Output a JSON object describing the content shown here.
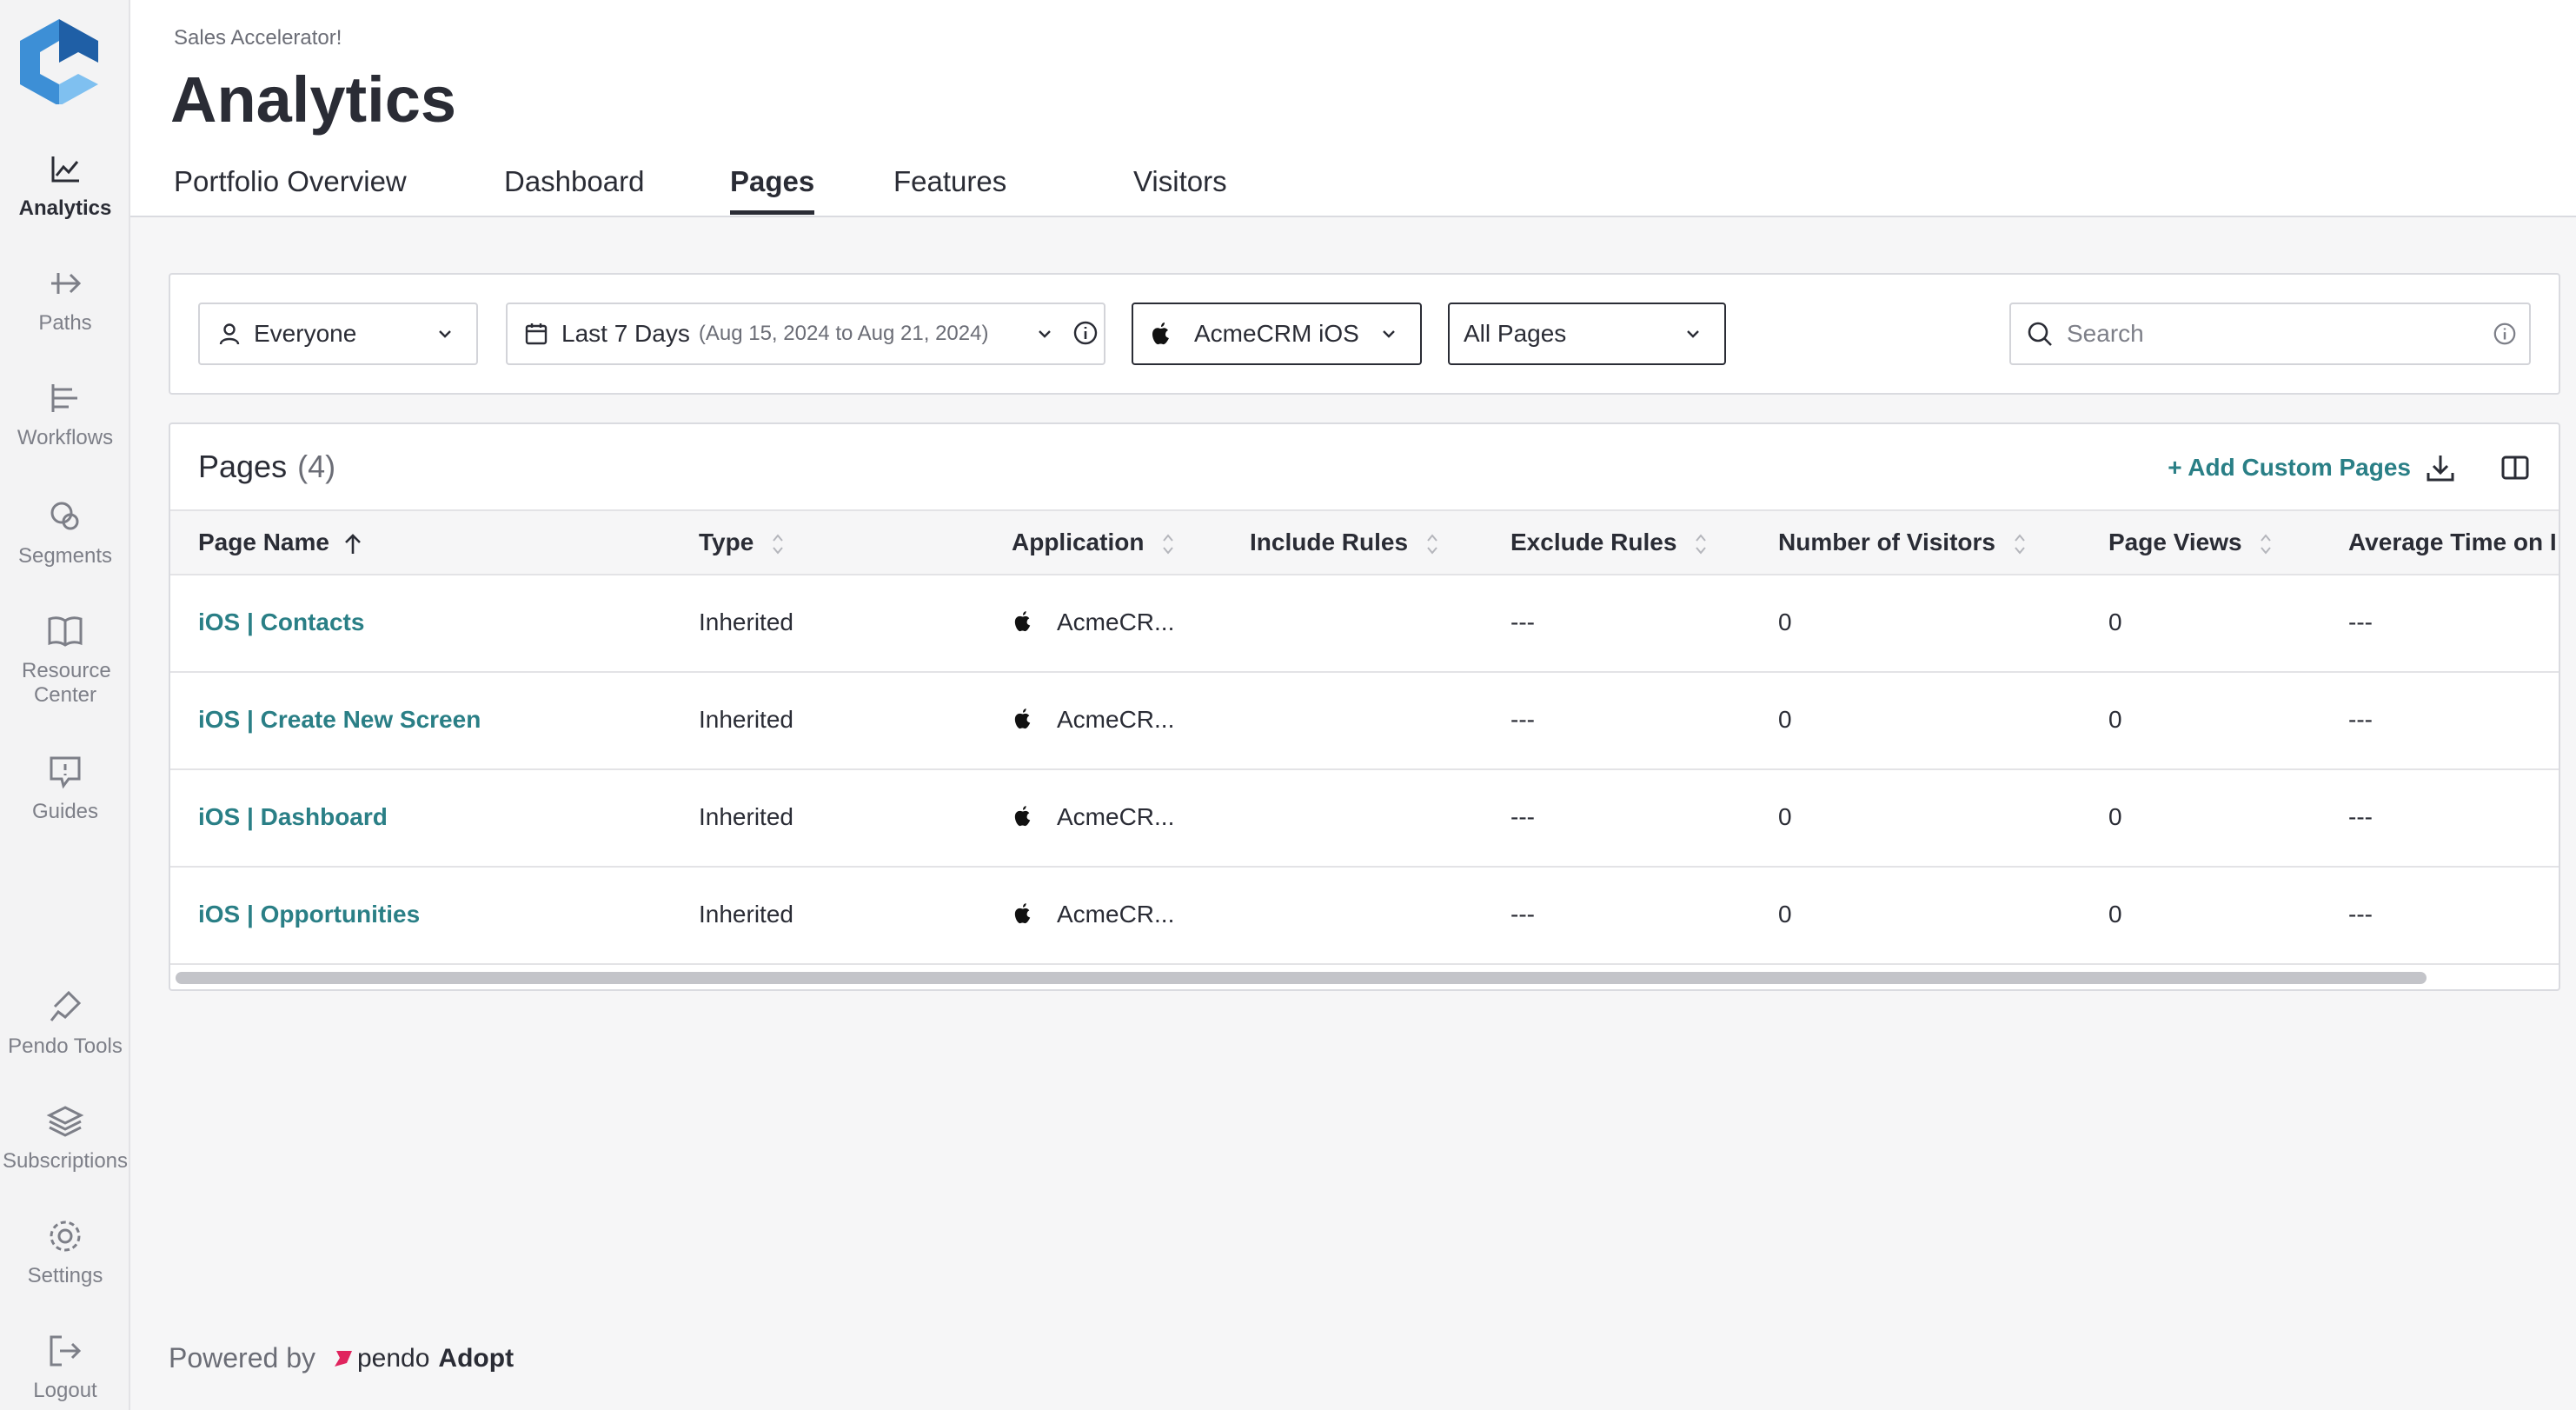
{
  "sidebar": {
    "items": [
      {
        "label": "Analytics",
        "icon": "chart-line-icon"
      },
      {
        "label": "Paths",
        "icon": "paths-icon"
      },
      {
        "label": "Workflows",
        "icon": "workflows-icon"
      },
      {
        "label": "Segments",
        "icon": "segments-icon"
      },
      {
        "label": "Resource Center",
        "icon": "book-icon"
      },
      {
        "label": "Guides",
        "icon": "guide-icon"
      },
      {
        "label": "Pendo Tools",
        "icon": "pin-icon"
      },
      {
        "label": "Subscriptions",
        "icon": "layers-icon"
      },
      {
        "label": "Settings",
        "icon": "gear-icon"
      },
      {
        "label": "Logout",
        "icon": "logout-icon"
      }
    ]
  },
  "header": {
    "breadcrumb": "Sales Accelerator!",
    "title": "Analytics",
    "tabs": [
      {
        "label": "Portfolio Overview"
      },
      {
        "label": "Dashboard"
      },
      {
        "label": "Pages",
        "active": true
      },
      {
        "label": "Features"
      },
      {
        "label": "Visitors"
      }
    ]
  },
  "filters": {
    "segment": "Everyone",
    "date_range": "Last 7 Days",
    "date_detail": "(Aug 15, 2024 to Aug 21, 2024)",
    "application": "AcmeCRM iOS",
    "page_filter": "All Pages",
    "search_placeholder": "Search"
  },
  "table": {
    "title": "Pages",
    "count": "(4)",
    "add_custom_label": "+ Add Custom Pages",
    "columns": [
      "Page Name",
      "Type",
      "Application",
      "Include Rules",
      "Exclude Rules",
      "Number of Visitors",
      "Page Views",
      "Average Time on I"
    ],
    "rows": [
      {
        "name": "iOS | Contacts",
        "type": "Inherited",
        "app": "AcmeCR...",
        "include": "",
        "exclude": "---",
        "visitors": "0",
        "views": "0",
        "avg_time": "---"
      },
      {
        "name": "iOS | Create New Screen",
        "type": "Inherited",
        "app": "AcmeCR...",
        "include": "",
        "exclude": "---",
        "visitors": "0",
        "views": "0",
        "avg_time": "---"
      },
      {
        "name": "iOS | Dashboard",
        "type": "Inherited",
        "app": "AcmeCR...",
        "include": "",
        "exclude": "---",
        "visitors": "0",
        "views": "0",
        "avg_time": "---"
      },
      {
        "name": "iOS | Opportunities",
        "type": "Inherited",
        "app": "AcmeCR...",
        "include": "",
        "exclude": "---",
        "visitors": "0",
        "views": "0",
        "avg_time": "---"
      }
    ]
  },
  "footer": {
    "powered_by": "Powered by",
    "brand": "pendo",
    "product": "Adopt"
  },
  "colors": {
    "accent_teal": "#2a7f86",
    "logo_blue": "#3d8fd6",
    "brand_pink": "#e0245e"
  }
}
